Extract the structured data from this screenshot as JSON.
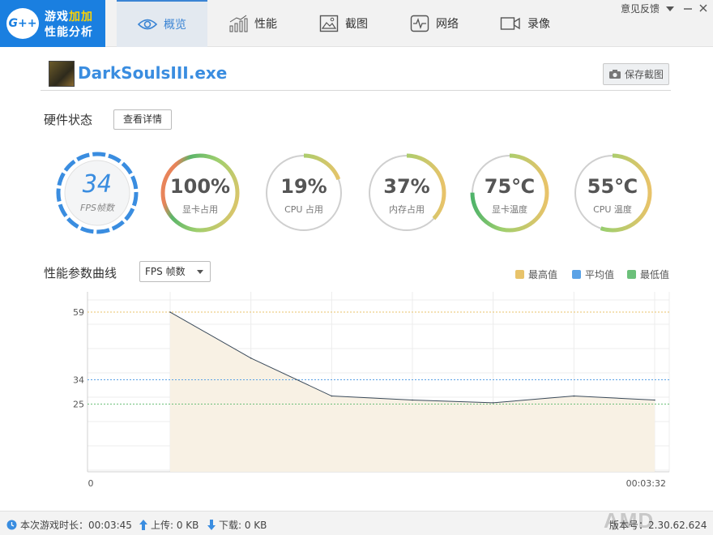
{
  "app": {
    "logo_badge": "G++",
    "logo_line1_a": "游戏",
    "logo_line1_b": "加加",
    "logo_line2": "性能分析"
  },
  "nav": {
    "tabs": [
      {
        "label": "概览",
        "icon": "eye-icon"
      },
      {
        "label": "性能",
        "icon": "bar-chart-icon"
      },
      {
        "label": "截图",
        "icon": "image-icon"
      },
      {
        "label": "网络",
        "icon": "heartbeat-icon"
      },
      {
        "label": "录像",
        "icon": "video-camera-icon"
      }
    ],
    "feedback": "意见反馈"
  },
  "header": {
    "process_name": "DarkSoulsIII.exe",
    "save_screenshot": "保存截图"
  },
  "hardware": {
    "title": "硬件状态",
    "detail_button": "查看详情",
    "fps": {
      "value": "34",
      "label": "FPS帧数"
    },
    "gauges": [
      {
        "value": "100%",
        "label": "显卡占用",
        "fill": 1.0
      },
      {
        "value": "19%",
        "label": "CPU 占用",
        "fill": 0.19
      },
      {
        "value": "37%",
        "label": "内存占用",
        "fill": 0.37
      },
      {
        "value": "75℃",
        "label": "显卡温度",
        "fill": 0.75
      },
      {
        "value": "55℃",
        "label": "CPU 温度",
        "fill": 0.55
      }
    ]
  },
  "curve": {
    "title": "性能参数曲线",
    "select_value": "FPS 帧数",
    "legend": [
      {
        "label": "最高值",
        "color": "#e8c36a"
      },
      {
        "label": "平均值",
        "color": "#5aa2e6"
      },
      {
        "label": "最低值",
        "color": "#6cc07a"
      }
    ]
  },
  "chart_data": {
    "type": "area",
    "x_start_label": "0",
    "x_end_label": "00:03:32",
    "y_ticks": [
      "59",
      "34",
      "25"
    ],
    "max": 59,
    "avg": 34,
    "min": 25,
    "values": [
      59,
      42,
      28,
      26.5,
      25.5,
      28,
      26.5
    ],
    "colors": {
      "max": "#e8c36a",
      "avg": "#5aa2e6",
      "min": "#6cc07a",
      "line": "#3a4a5a",
      "fill": "#f8f1e4"
    }
  },
  "status": {
    "duration": "本次游戏时长：00:03:45",
    "upload": "上传: 0 KB",
    "download": "下载: 0 KB",
    "brand": "AMD",
    "version": "版本号：2.30.62.624"
  }
}
